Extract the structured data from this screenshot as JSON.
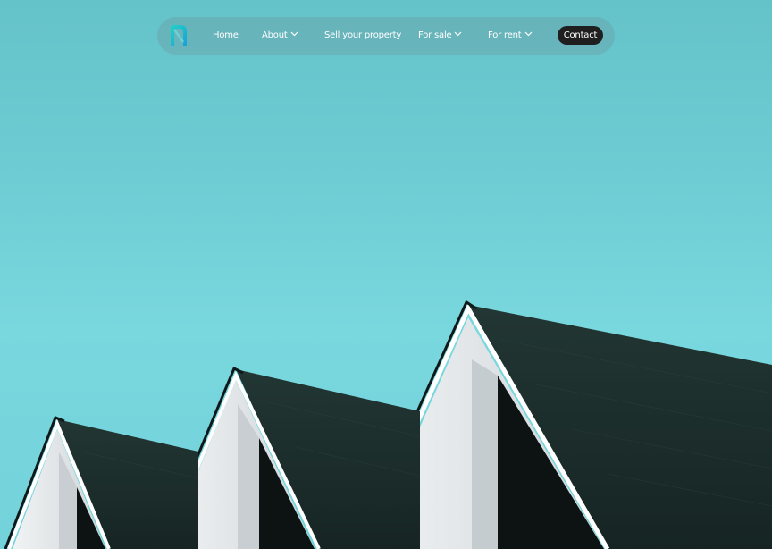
{
  "nav": {
    "logo_icon": "brand-logo-icon",
    "items": [
      {
        "label": "Home",
        "has_dropdown": false
      },
      {
        "label": "About",
        "has_dropdown": true
      },
      {
        "label": "Sell your property",
        "has_dropdown": false
      },
      {
        "label": "For sale",
        "has_dropdown": true
      },
      {
        "label": "For rent",
        "has_dropdown": true
      }
    ],
    "contact_label": "Contact"
  },
  "colors": {
    "sky": "#6fcfd6",
    "roof": "#1b2b2a",
    "wall": "#e4e8ea",
    "contact_bg": "#1f1f1f",
    "logo_accent": "#1fc6bd"
  }
}
